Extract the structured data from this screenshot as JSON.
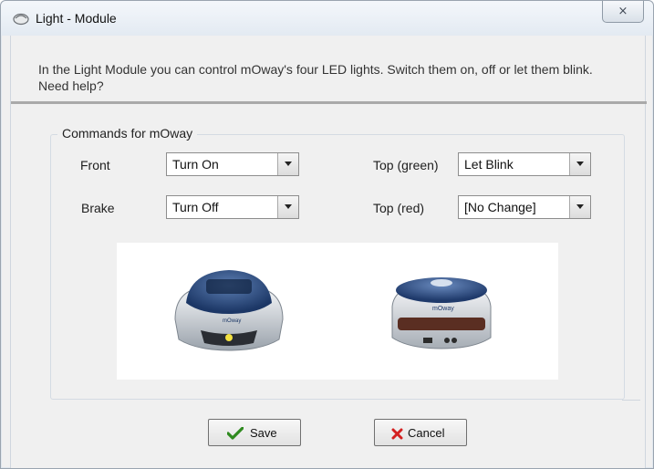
{
  "window": {
    "title": "Light - Module",
    "close_label": "⨯"
  },
  "intro_text": "In the Light Module you can control mOway's four LED lights. Switch them on, off or let them blink. Need help?",
  "group": {
    "caption": "Commands for mOway"
  },
  "commands": {
    "front": {
      "label": "Front",
      "value": "Turn On"
    },
    "brake": {
      "label": "Brake",
      "value": "Turn Off"
    },
    "top_green": {
      "label": "Top (green)",
      "value": "Let Blink"
    },
    "top_red": {
      "label": "Top (red)",
      "value": "[No Change]"
    }
  },
  "robot_brand": "mOway",
  "buttons": {
    "save_label": "Save",
    "cancel_label": "Cancel"
  },
  "colors": {
    "save_check": "#2f8a1f",
    "cancel_x": "#d42020",
    "robot_blue": "#1f3f73"
  }
}
